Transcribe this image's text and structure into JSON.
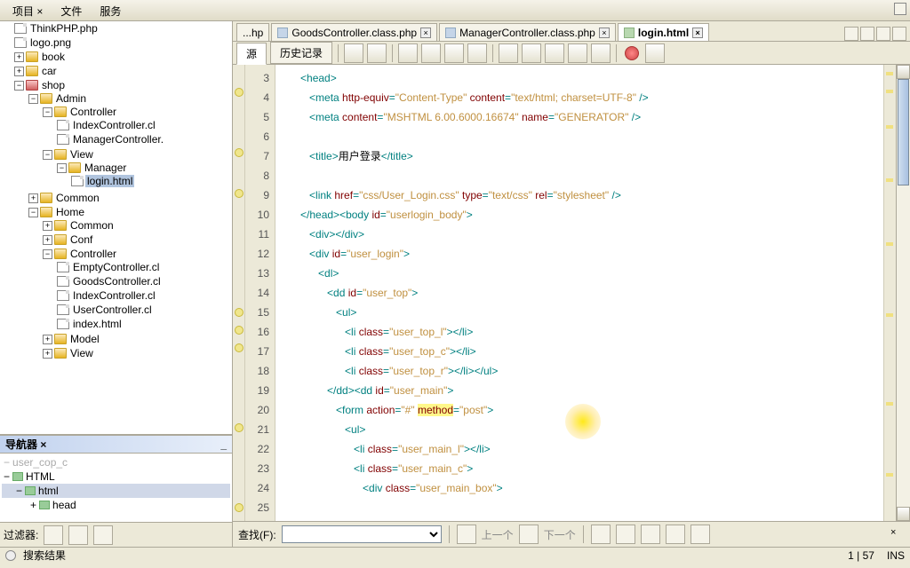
{
  "menu": {
    "project": "项目 ×",
    "file": "文件",
    "service": "服务"
  },
  "tree": {
    "items": [
      "ThinkPHP.php",
      "logo.png",
      "book",
      "car",
      "shop",
      "Admin",
      "Controller",
      "IndexController.cl",
      "ManagerController.",
      "View",
      "Manager",
      "login.html",
      "Common",
      "Home",
      "Common",
      "Conf",
      "Controller",
      "EmptyController.cl",
      "GoodsController.cl",
      "IndexController.cl",
      "UserController.cl",
      "index.html",
      "Model",
      "View"
    ]
  },
  "nav": {
    "title": "导航器 ×",
    "items": [
      "user_cop_c",
      "HTML",
      "html",
      "head"
    ]
  },
  "filter": {
    "label": "过滤器:"
  },
  "tabs": {
    "t1": "...hp",
    "t2": "GoodsController.class.php",
    "t3": "ManagerController.class.php",
    "t4": "login.html"
  },
  "subtabs": {
    "source": "源",
    "history": "历史记录"
  },
  "gutter": {
    "start": 3,
    "end": 25
  },
  "code": {
    "l3": {
      "tag": "head"
    },
    "l4": {
      "tag": "meta",
      "a1": "http-equiv",
      "v1": "Content-Type",
      "a2": "content",
      "v2": "text/html; charset=UTF-8"
    },
    "l5": {
      "tag": "meta",
      "a1": "content",
      "v1": "MSHTML 6.00.6000.16674",
      "a2": "name",
      "v2": "GENERATOR"
    },
    "l7": {
      "tag": "title",
      "text": "用户登录"
    },
    "l9": {
      "tag": "link",
      "a1": "href",
      "v1": "css/User_Login.css",
      "a2": "type",
      "v2": "text/css",
      "a3": "rel",
      "v3": "stylesheet"
    },
    "l10": {
      "t1": "head",
      "t2": "body",
      "a1": "id",
      "v1": "userlogin_body"
    },
    "l11": {
      "tag": "div"
    },
    "l12": {
      "tag": "div",
      "a1": "id",
      "v1": "user_login"
    },
    "l13": {
      "tag": "dl"
    },
    "l14": {
      "tag": "dd",
      "a1": "id",
      "v1": "user_top"
    },
    "l15": {
      "tag": "ul"
    },
    "l16": {
      "tag": "li",
      "a1": "class",
      "v1": "user_top_l"
    },
    "l17": {
      "tag": "li",
      "a1": "class",
      "v1": "user_top_c"
    },
    "l18": {
      "tag": "li",
      "a1": "class",
      "v1": "user_top_r",
      "tag2": "ul"
    },
    "l19": {
      "t1": "dd",
      "t2": "dd",
      "a1": "id",
      "v1": "user_main"
    },
    "l20": {
      "tag": "form",
      "a1": "action",
      "v1": "#",
      "a2": "method",
      "v2": "post"
    },
    "l21": {
      "tag": "ul"
    },
    "l22": {
      "tag": "li",
      "a1": "class",
      "v1": "user_main_l"
    },
    "l23": {
      "tag": "li",
      "a1": "class",
      "v1": "user_main_c"
    },
    "l24": {
      "tag": "div",
      "a1": "class",
      "v1": "user_main_box"
    }
  },
  "find": {
    "label": "查找(F):",
    "prev": "上一个",
    "next": "下一个"
  },
  "status": {
    "search": "搜索结果",
    "pos": "1 | 57",
    "ins": "INS"
  }
}
